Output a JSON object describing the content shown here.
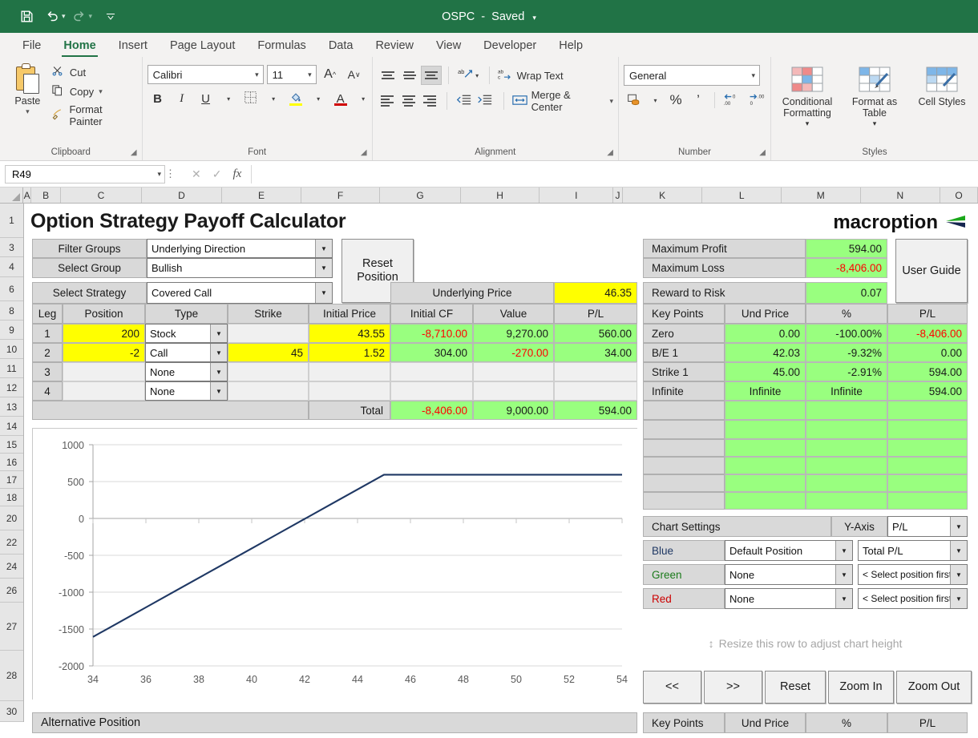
{
  "titlebar": {
    "document_title": "OSPC",
    "save_state": "Saved",
    "qat": [
      {
        "name": "save-icon",
        "glyph": "὚B"
      },
      {
        "name": "undo-icon",
        "glyph": "↶"
      },
      {
        "name": "redo-icon",
        "glyph": "↷"
      },
      {
        "name": "customize-quick-access-toolbar-icon",
        "glyph": "⤓"
      }
    ]
  },
  "ribbon": {
    "tabs": [
      {
        "label": "File",
        "active": false
      },
      {
        "label": "Home",
        "active": true
      },
      {
        "label": "Insert",
        "active": false
      },
      {
        "label": "Page Layout",
        "active": false
      },
      {
        "label": "Formulas",
        "active": false
      },
      {
        "label": "Data",
        "active": false
      },
      {
        "label": "Review",
        "active": false
      },
      {
        "label": "View",
        "active": false
      },
      {
        "label": "Developer",
        "active": false
      },
      {
        "label": "Help",
        "active": false
      }
    ],
    "clipboard": {
      "group_label": "Clipboard",
      "paste_label": "Paste",
      "cut_label": "Cut",
      "copy_label": "Copy",
      "format_painter_label": "Format Painter"
    },
    "font": {
      "group_label": "Font",
      "font_name": "Calibri",
      "font_size": "11",
      "bold_label": "B",
      "italic_label": "I",
      "underline_label": "U",
      "grow_font_label": "A",
      "shrink_font_label": "A"
    },
    "alignment": {
      "group_label": "Alignment",
      "wrap_text_label": "Wrap Text",
      "merge_center_label": "Merge & Center"
    },
    "number": {
      "group_label": "Number",
      "format": "General",
      "percent_label": "%",
      "comma_label": "’"
    },
    "styles": {
      "group_label": "Styles",
      "conditional_formatting_label": "Conditional Formatting",
      "format_as_table_label": "Format as Table",
      "cell_styles_label": "Cell Styles"
    }
  },
  "formula_bar": {
    "name_box": "R49",
    "cancel_icon": "✕",
    "enter_icon": "✓",
    "function_icon": "fx",
    "formula_value": ""
  },
  "grid": {
    "columns": [
      "A",
      "B",
      "C",
      "D",
      "E",
      "F",
      "G",
      "H",
      "I",
      "J",
      "K",
      "L",
      "M",
      "N",
      "O"
    ],
    "rows": [
      "1",
      "3",
      "4",
      "6",
      "8",
      "9",
      "10",
      "11",
      "12",
      "13",
      "14",
      "15",
      "16",
      "17",
      "18",
      "20",
      "22",
      "24",
      "26",
      "27",
      "28",
      "30"
    ]
  },
  "sheet": {
    "page_title": "Option Strategy Payoff Calculator",
    "brand": "macroption",
    "controls": {
      "filter_groups_label": "Filter Groups",
      "filter_groups_value": "Underlying Direction",
      "select_group_label": "Select Group",
      "select_group_value": "Bullish",
      "select_strategy_label": "Select Strategy",
      "select_strategy_value": "Covered Call",
      "reset_position_label": "Reset Position",
      "user_guide_label": "User Guide",
      "underlying_price_label": "Underlying Price",
      "underlying_price_value": "46.35"
    },
    "summary": {
      "max_profit_label": "Maximum Profit",
      "max_profit_value": "594.00",
      "max_loss_label": "Maximum Loss",
      "max_loss_value": "-8,406.00",
      "reward_risk_label": "Reward to Risk",
      "reward_risk_value": "0.07"
    },
    "legs_table": {
      "headers": [
        "Leg",
        "Position",
        "Type",
        "Strike",
        "Initial Price",
        "Initial CF",
        "Value",
        "P/L"
      ],
      "rows": [
        {
          "leg": "1",
          "position": "200",
          "type": "Stock",
          "strike": "",
          "initial_price": "43.55",
          "initial_cf": "-8,710.00",
          "value": "9,270.00",
          "pl": "560.00"
        },
        {
          "leg": "2",
          "position": "-2",
          "type": "Call",
          "strike": "45",
          "initial_price": "1.52",
          "initial_cf": "304.00",
          "value": "-270.00",
          "pl": "34.00"
        },
        {
          "leg": "3",
          "position": "",
          "type": "None",
          "strike": "",
          "initial_price": "",
          "initial_cf": "",
          "value": "",
          "pl": ""
        },
        {
          "leg": "4",
          "position": "",
          "type": "None",
          "strike": "",
          "initial_price": "",
          "initial_cf": "",
          "value": "",
          "pl": ""
        }
      ],
      "total_label": "Total",
      "total_initial_cf": "-8,406.00",
      "total_value": "9,000.00",
      "total_pl": "594.00"
    },
    "key_points": {
      "headers": [
        "Key Points",
        "Und Price",
        "%",
        "P/L"
      ],
      "rows": [
        {
          "name": "Zero",
          "und_price": "0.00",
          "pct": "-100.00%",
          "pl": "-8,406.00"
        },
        {
          "name": "B/E 1",
          "und_price": "42.03",
          "pct": "-9.32%",
          "pl": "0.00"
        },
        {
          "name": "Strike 1",
          "und_price": "45.00",
          "pct": "-2.91%",
          "pl": "594.00"
        },
        {
          "name": "Infinite",
          "und_price": "Infinite",
          "pct": "Infinite",
          "pl": "594.00"
        }
      ],
      "empty_row_count": 6
    },
    "chart_settings": {
      "title": "Chart Settings",
      "y_axis_label": "Y-Axis",
      "y_axis_value": "P/L",
      "series": [
        {
          "color_label": "Blue",
          "color_hex": "#1f3864",
          "position": "Default Position",
          "metric": "Total P/L"
        },
        {
          "color_label": "Green",
          "color_hex": "#1a7a1a",
          "position": "None",
          "metric": "< Select position first"
        },
        {
          "color_label": "Red",
          "color_hex": "#cc0000",
          "position": "None",
          "metric": "< Select position first"
        }
      ]
    },
    "resize_hint": "Resize this row to adjust chart height",
    "chart_buttons": [
      {
        "label": "<<",
        "name": "chart-pan-left-button"
      },
      {
        "label": ">>",
        "name": "chart-pan-right-button"
      },
      {
        "label": "Reset",
        "name": "chart-reset-button"
      },
      {
        "label": "Zoom In",
        "name": "chart-zoom-in-button"
      },
      {
        "label": "Zoom Out",
        "name": "chart-zoom-out-button"
      }
    ],
    "key_points_footer_headers": [
      "Key Points",
      "Und Price",
      "%",
      "P/L"
    ],
    "alternative_position_label": "Alternative Position"
  },
  "chart_data": {
    "type": "line",
    "title": "",
    "xlabel": "",
    "ylabel": "",
    "xlim": [
      34,
      54
    ],
    "ylim": [
      -2000,
      1000
    ],
    "xticks": [
      34,
      36,
      38,
      40,
      42,
      44,
      46,
      48,
      50,
      52,
      54
    ],
    "yticks": [
      -2000,
      -1500,
      -1000,
      -500,
      0,
      500,
      1000
    ],
    "grid": true,
    "legend_position": "none",
    "series": [
      {
        "name": "Total P/L",
        "color": "#1f3864",
        "x": [
          34,
          36,
          38,
          40,
          42,
          42.03,
          44,
          45,
          46,
          48,
          50,
          52,
          54
        ],
        "values": [
          -1606,
          -1206,
          -806,
          -406,
          -6,
          0,
          394,
          594,
          594,
          594,
          594,
          594,
          594
        ]
      }
    ]
  }
}
